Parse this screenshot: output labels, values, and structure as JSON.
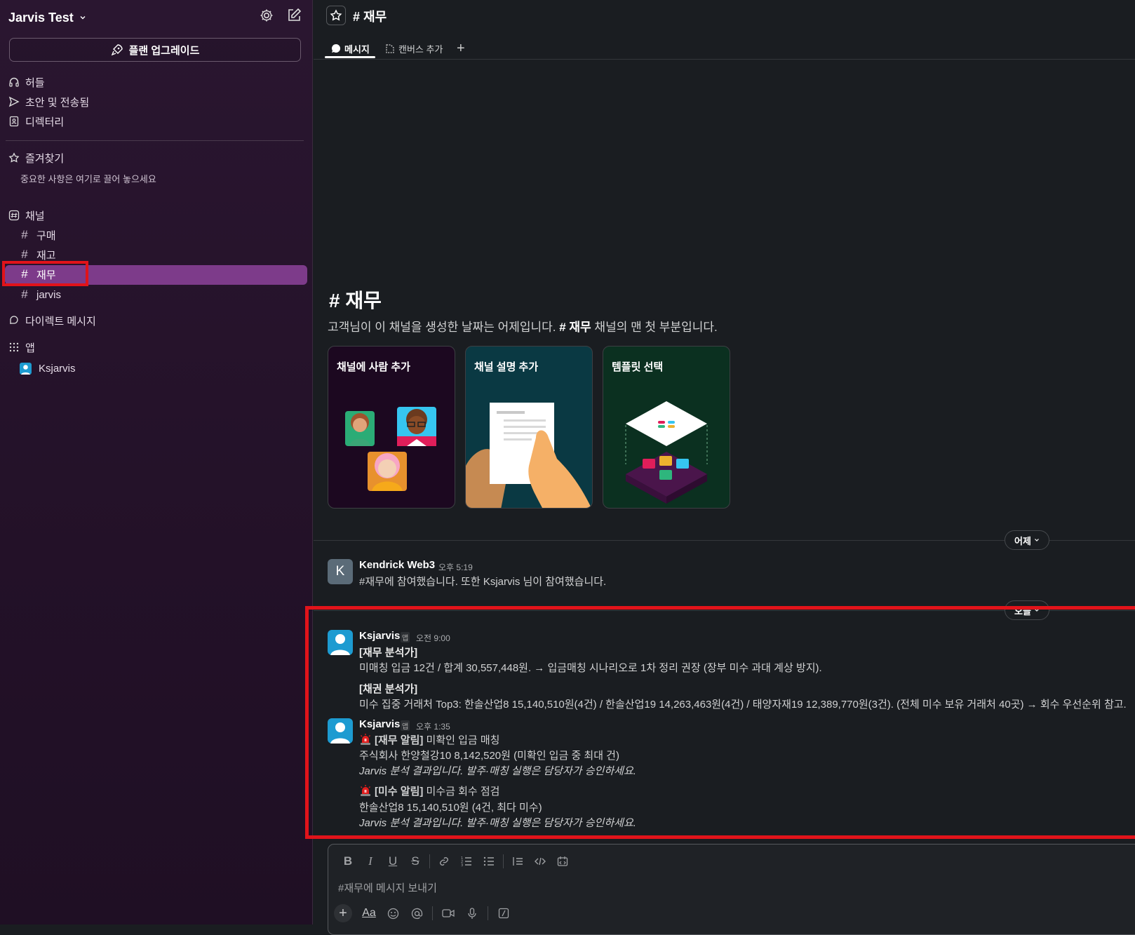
{
  "workspace": {
    "name": "Jarvis Test"
  },
  "sidebar": {
    "upgrade_label": "플랜 업그레이드",
    "nav": [
      {
        "label": "허들",
        "icon": "headphones-icon"
      },
      {
        "label": "초안 및 전송됨",
        "icon": "send-icon"
      },
      {
        "label": "디렉터리",
        "icon": "directory-icon"
      }
    ],
    "favorites": {
      "label": "즐겨찾기",
      "hint": "중요한 사항은 여기로 끌어 놓으세요"
    },
    "channels_label": "채널",
    "channels": [
      "구매",
      "재고",
      "재무",
      "jarvis"
    ],
    "active_channel": "재무",
    "dm_label": "다이렉트 메시지",
    "apps_label": "앱",
    "apps": [
      "Ksjarvis"
    ]
  },
  "header": {
    "channel_name": "# 재무",
    "tabs": [
      "메시지",
      "캔버스 추가"
    ]
  },
  "intro": {
    "title": "# 재무",
    "text_before": "고객님이 이 채널을 생성한 날짜는 어제입니다. ",
    "text_channel": "# 재무",
    "text_after": " 채널의 맨 첫 부분입니다.",
    "cards": [
      "채널에 사람 추가",
      "채널 설명 추가",
      "템플릿 선택"
    ]
  },
  "dividers": {
    "yesterday": "어제",
    "today": "오늘"
  },
  "messages": [
    {
      "sender": "Kendrick Web3",
      "avatar_letter": "K",
      "time": "오후 5:19",
      "lines": [
        "#재무에 참여했습니다. 또한 Ksjarvis 님이 참여했습니다."
      ]
    },
    {
      "sender": "Ksjarvis",
      "app_tag": "앱",
      "time": "오전 9:00",
      "lines": [
        "[재무 분석가]",
        "미매칭 입금 12건 / 합계 30,557,448원. → 입금매칭 시나리오로 1차 정리 권장 (장부 미수 과대 계상 방지).",
        "[채권 분석가]",
        "미수 집중 거래처 Top3: 한솔산업8 15,140,510원(4건) / 한솔산업19 14,263,463원(4건) / 태양자재19 12,389,770원(3건). (전체 미수 보유 거래처 40곳) → 회수 우선순위 참고."
      ]
    },
    {
      "sender": "Ksjarvis",
      "app_tag": "앱",
      "time": "오후 1:35",
      "alert1_title": "[재무 알림]",
      "alert1_rest": " 미확인 입금 매칭",
      "alert1_detail": "주식회사 한양철강10 8,142,520원 (미확인 입금 중 최대 건)",
      "alert1_note": "Jarvis 분석 결과입니다. 발주·매칭 실행은 담당자가 승인하세요.",
      "alert2_title": "[미수 알림]",
      "alert2_rest": " 미수금 회수 점검",
      "alert2_detail": "한솔산업8 15,140,510원 (4건, 최다 미수)",
      "alert2_note": "Jarvis 분석 결과입니다. 발주·매칭 실행은 담당자가 승인하세요."
    }
  ],
  "composer": {
    "placeholder": "#재무에 메시지 보내기",
    "font_label": "Aa"
  },
  "colors": {
    "sidebar_active": "#7d3b8a",
    "highlight_box": "#e1131a",
    "app_avatar": "#1d9bd1"
  }
}
